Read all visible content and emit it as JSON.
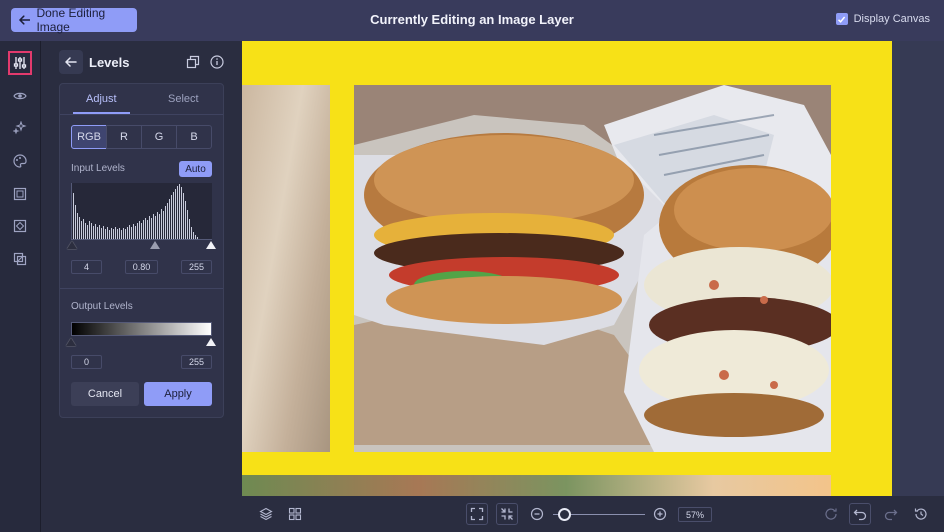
{
  "topbar": {
    "done_label": "Done Editing Image",
    "title": "Currently Editing an Image Layer",
    "display_canvas_label": "Display Canvas",
    "display_canvas_checked": true
  },
  "rail": {
    "items": [
      "sliders",
      "eye",
      "sparkles",
      "palette",
      "frame",
      "crop-frame",
      "layers-blend"
    ],
    "active": "sliders"
  },
  "panel": {
    "title": "Levels",
    "tabs": [
      {
        "label": "Adjust",
        "active": true
      },
      {
        "label": "Select",
        "active": false
      }
    ],
    "channels": [
      "RGB",
      "R",
      "G",
      "B"
    ],
    "selected_channel": "RGB",
    "input_levels": {
      "label": "Input Levels",
      "auto_label": "Auto",
      "black": "4",
      "gamma": "0.80",
      "white": "255"
    },
    "output_levels": {
      "label": "Output Levels",
      "black": "0",
      "white": "255"
    },
    "cancel_label": "Cancel",
    "apply_label": "Apply"
  },
  "bottombar": {
    "zoom_label": "57%"
  },
  "colors": {
    "accent": "#8f9cf7",
    "topbar": "#393b5c",
    "canvas_yellow": "#f7e117",
    "active_outline": "#e23a6d"
  }
}
